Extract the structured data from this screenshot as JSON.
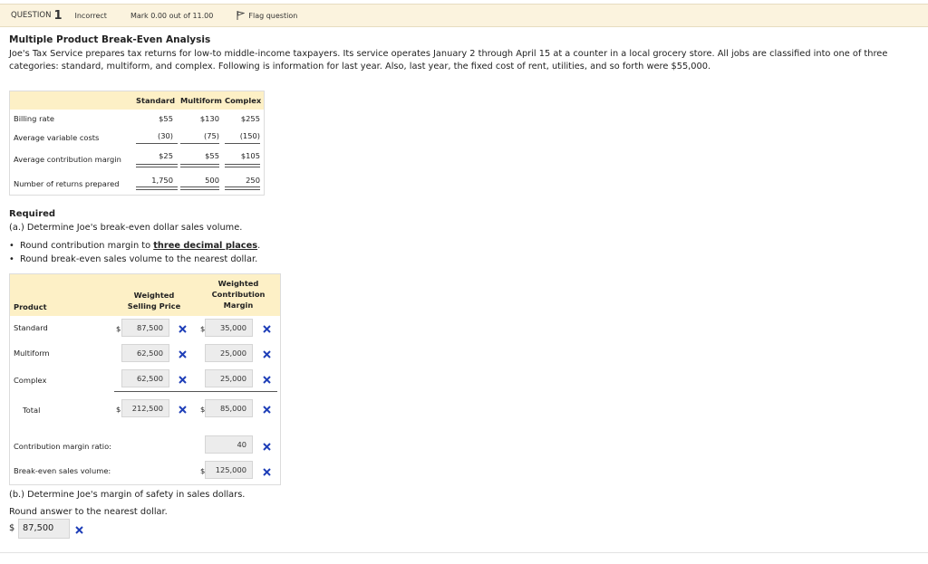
{
  "header": {
    "question_label": "QUESTION",
    "question_number": "1",
    "status": "Incorrect",
    "mark": "Mark 0.00 out of 11.00",
    "flag_label": "Flag question"
  },
  "title": "Multiple Product Break-Even Analysis",
  "intro": "Joe's Tax Service prepares tax returns for low-to middle-income taxpayers. Its service operates January 2 through April 15 at a counter in a local grocery store. All jobs are classified into one of three categories: standard, multiform, and complex. Following is information for last year. Also, last year, the fixed cost of rent, utilities, and so forth were $55,000.",
  "info_table": {
    "columns": [
      "Standard",
      "Multiform",
      "Complex"
    ],
    "rows": [
      {
        "label": "Billing rate",
        "values": [
          "$55",
          "$130",
          "$255"
        ]
      },
      {
        "label": "Average variable costs",
        "values": [
          "(30)",
          "(75)",
          "(150)"
        ]
      },
      {
        "label": "Average contribution margin",
        "values": [
          "$25",
          "$55",
          "$105"
        ]
      },
      {
        "label": "Number of returns prepared",
        "values": [
          "1,750",
          "500",
          "250"
        ]
      }
    ]
  },
  "required": {
    "heading": "Required",
    "part_a": "(a.) Determine Joe's break-even dollar sales volume.",
    "bullet1_pre": "Round contribution margin to ",
    "bullet1_emph": "three decimal places",
    "bullet1_post": ".",
    "bullet2": "Round break-even sales volume to the nearest dollar."
  },
  "answer_table": {
    "col_product": "Product",
    "col_wsp_line1": "Weighted",
    "col_wsp_line2": "Selling Price",
    "col_wcm_line1": "Weighted",
    "col_wcm_line2": "Contribution",
    "col_wcm_line3": "Margin",
    "currency": "$",
    "rows": [
      {
        "label": "Standard",
        "wsp": "87,500",
        "wcm": "35,000"
      },
      {
        "label": "Multiform",
        "wsp": "62,500",
        "wcm": "25,000"
      },
      {
        "label": "Complex",
        "wsp": "62,500",
        "wcm": "25,000"
      },
      {
        "label": "Total",
        "wsp": "212,500",
        "wcm": "85,000"
      }
    ],
    "cm_ratio_label": "Contribution margin ratio:",
    "cm_ratio_value": "40",
    "bev_label": "Break-even sales volume:",
    "bev_value": "125,000"
  },
  "part_b": {
    "title": "(b.) Determine Joe's margin of safety in sales dollars.",
    "round": "Round answer to the nearest dollar.",
    "currency": "$",
    "value": "87,500"
  },
  "colors": {
    "header_bg": "#fbf3de",
    "table_head_bg": "#fdf0c6",
    "incorrect_x": "#1f3fb8"
  },
  "icons": [
    "flag-icon",
    "incorrect-x-icon"
  ]
}
